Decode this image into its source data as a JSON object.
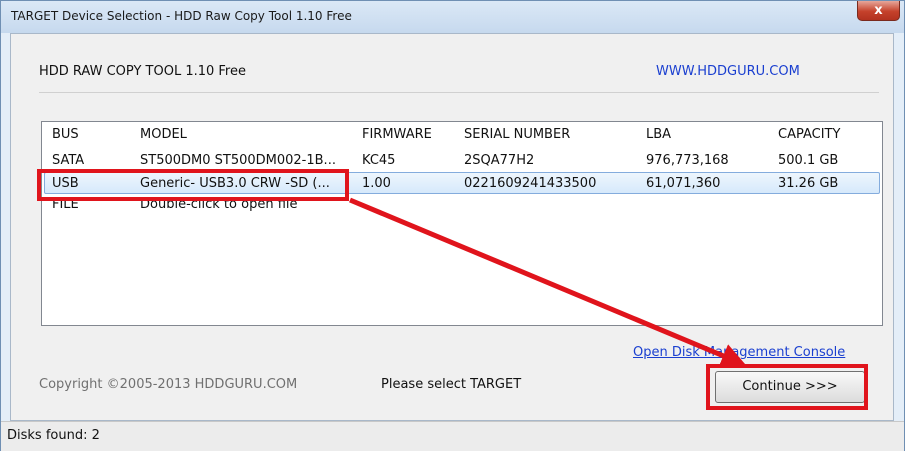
{
  "window": {
    "title": "TARGET Device Selection - HDD Raw Copy Tool 1.10   Free",
    "close_glyph": "x"
  },
  "header": {
    "app_name": "HDD RAW COPY TOOL 1.10   Free",
    "website": "WWW.HDDGURU.COM"
  },
  "device_list": {
    "columns": [
      "BUS",
      "MODEL",
      "FIRMWARE",
      "SERIAL NUMBER",
      "LBA",
      "CAPACITY"
    ],
    "rows": [
      {
        "bus": "SATA",
        "model": "ST500DM0 ST500DM002-1B...",
        "firmware": "KC45",
        "serial": "2SQA77H2",
        "lba": "976,773,168",
        "capacity": "500.1 GB"
      },
      {
        "bus": "USB",
        "model": "Generic- USB3.0 CRW   -SD (...",
        "firmware": "1.00",
        "serial": "0221609241433500",
        "lba": "61,071,360",
        "capacity": "31.26 GB"
      },
      {
        "bus": "FILE",
        "model": "Double-click to open file",
        "firmware": "",
        "serial": "",
        "lba": "",
        "capacity": ""
      }
    ],
    "selected_row": 1
  },
  "footer": {
    "disk_management_link": "Open Disk Management Console",
    "copyright": "Copyright ©2005-2013 HDDGURU.COM",
    "status_message": "Please select TARGET",
    "continue_label": "Continue >>>"
  },
  "statusbar": {
    "text": "Disks found: 2"
  },
  "annotation": {
    "highlight_color": "#e0141c"
  }
}
